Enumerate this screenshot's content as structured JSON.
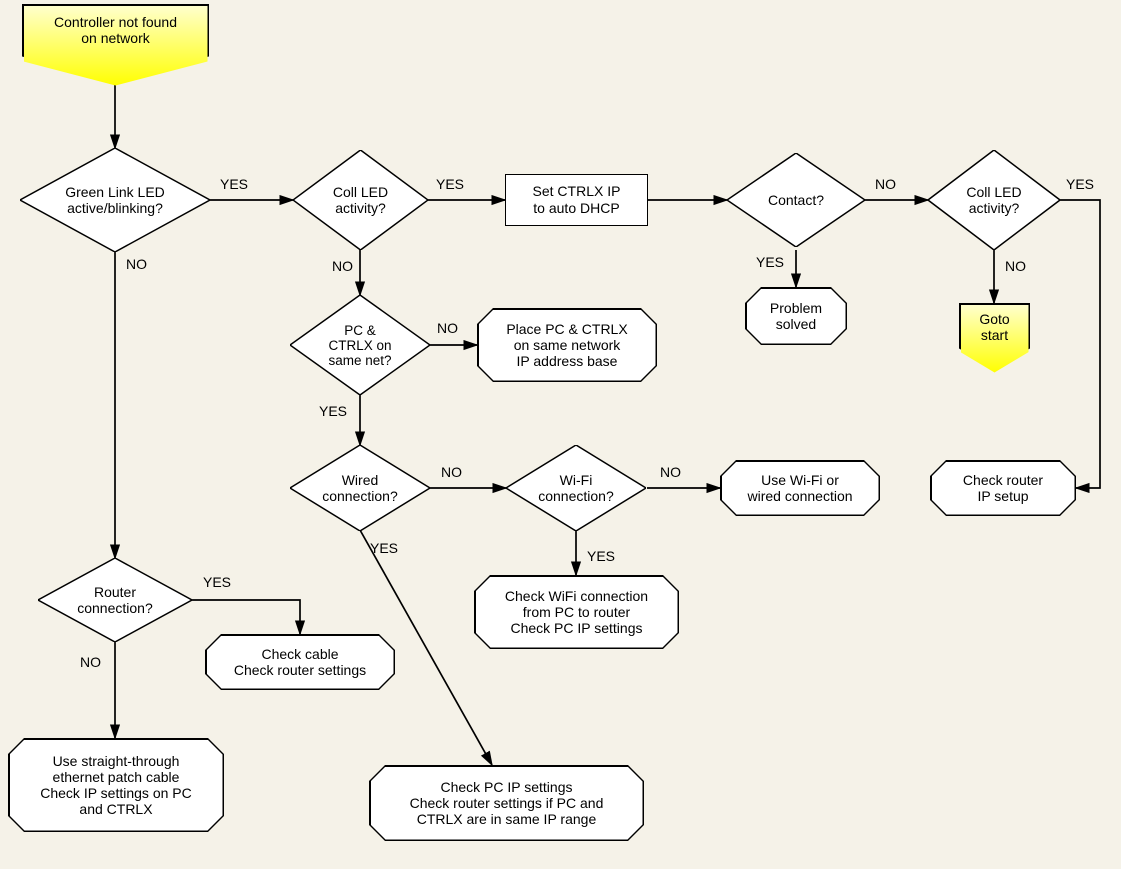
{
  "start": {
    "text": "Controller not found\non network"
  },
  "goto": {
    "text": "Goto\nstart"
  },
  "decisions": {
    "greenlink": "Green Link LED\nactive/blinking?",
    "coll1": "Coll LED\nactivity?",
    "contact": "Contact?",
    "coll2": "Coll LED\nactivity?",
    "samenet": "PC &\nCTRLX on\nsame net?",
    "wired": "Wired\nconnection?",
    "wifi": "Wi-Fi\nconnection?",
    "router": "Router\nconnection?"
  },
  "processes": {
    "dhcp": "Set CTRLX IP\nto auto DHCP"
  },
  "octagons": {
    "solved": "Problem\nsolved",
    "checkrouter": "Check router\nIP setup",
    "placepc": "Place PC & CTRLX\non same network\nIP address base",
    "usewifi": "Use Wi-Fi or\nwired connection",
    "checkwifi": "Check WiFi connection\nfrom PC to router\nCheck PC IP settings",
    "checkcable": "Check cable\nCheck router settings",
    "usestraight": "Use straight-through\nethernet patch cable\nCheck IP settings on PC\nand CTRLX",
    "checkpcip": "Check PC IP settings\nCheck router settings if PC and\nCTRLX are in same IP range"
  },
  "labels": {
    "yes": "YES",
    "no": "NO"
  }
}
